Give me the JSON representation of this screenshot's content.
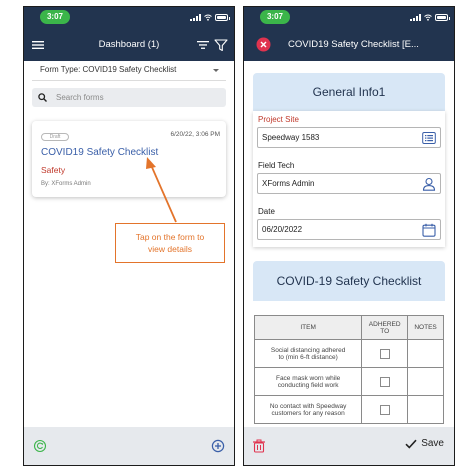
{
  "left_phone": {
    "status_time": "3:07",
    "title": "Dashboard (1)",
    "form_type": "Form Type: COVID19 Safety Checklist",
    "search_placeholder": "Search forms",
    "card": {
      "badge": "Draft",
      "date": "6/20/22, 3:06 PM",
      "title": "COVID19 Safety Checklist",
      "category": "Safety",
      "author": "By: XForms Admin"
    },
    "callout": {
      "line1": "Tap on the form to",
      "line2": "view details"
    }
  },
  "right_phone": {
    "status_time": "3:07",
    "title": "COVID19 Safety Checklist [E...",
    "general": {
      "header": "General Info1",
      "project_site_label": "Project Site",
      "project_site_value": "Speedway 1583",
      "field_tech_label": "Field Tech",
      "field_tech_value": "XForms Admin",
      "date_label": "Date",
      "date_value": "06/20/2022"
    },
    "checklist": {
      "header": "COVID-19 Safety Checklist",
      "col_item": "ITEM",
      "col_adhered_1": "ADHERED",
      "col_adhered_2": "TO",
      "col_notes": "NOTES",
      "rows": [
        {
          "l1": "Social distancing adhered",
          "l2": "to (min 6-ft distance)"
        },
        {
          "l1": "Face mask worn while",
          "l2": "conducting field work"
        },
        {
          "l1": "No contact with Speedway",
          "l2": "customers for any reason"
        }
      ]
    },
    "save_label": "Save"
  },
  "colors": {
    "navy": "#22344f",
    "status_green": "#3bb54a",
    "link_blue": "#3a5fa8",
    "red": "#c0392b",
    "orange": "#e3742b",
    "section_blue": "#d8e7f6",
    "close_red": "#e0334f"
  },
  "icons": [
    "hamburger-icon",
    "sort-icon",
    "filter-icon",
    "search-icon",
    "refresh-icon",
    "add-circle-icon",
    "close-circle-icon",
    "list-icon",
    "user-icon",
    "calendar-icon",
    "trash-icon",
    "checkmark-icon"
  ]
}
